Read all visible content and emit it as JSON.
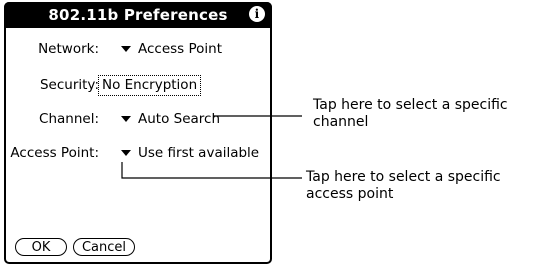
{
  "dialog": {
    "title": "802.11b Preferences",
    "info_icon": "i"
  },
  "fields": {
    "network": {
      "label": "Network:",
      "value": "Access Point"
    },
    "security": {
      "label": "Security:",
      "value": "No Encryption"
    },
    "channel": {
      "label": "Channel:",
      "value": "Auto Search"
    },
    "access_point": {
      "label": "Access Point:",
      "value": "Use first available"
    }
  },
  "buttons": {
    "ok": "OK",
    "cancel": "Cancel"
  },
  "callouts": {
    "channel": [
      "Tap here to select a specific",
      "channel"
    ],
    "access_point": [
      "Tap here to select a specific",
      "access point"
    ]
  }
}
